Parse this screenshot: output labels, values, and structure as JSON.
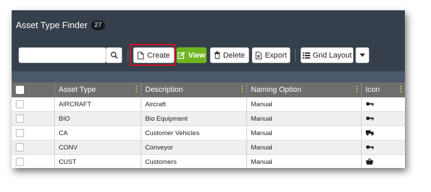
{
  "header": {
    "title": "Asset Type Finder",
    "count": "27"
  },
  "toolbar": {
    "search_placeholder": "",
    "create_label": "Create",
    "view_label": "View",
    "delete_label": "Delete",
    "export_label": "Export",
    "grid_label": "Grid Layout"
  },
  "table": {
    "columns": [
      "Asset Type",
      "Description",
      "Naming Option",
      "Icon"
    ],
    "rows": [
      {
        "type": "AIRCRAFT",
        "description": "Aircraft",
        "naming": "Manual",
        "icon": "key-icon"
      },
      {
        "type": "BIO",
        "description": "Bio Equipment",
        "naming": "Manual",
        "icon": "key-icon"
      },
      {
        "type": "CA",
        "description": "Customer Vehicles",
        "naming": "Manual",
        "icon": "truck-icon"
      },
      {
        "type": "CONV",
        "description": "Conveyor",
        "naming": "Manual",
        "icon": "key-icon"
      },
      {
        "type": "CUST",
        "description": "Customers",
        "naming": "Manual",
        "icon": "basket-icon"
      }
    ]
  },
  "colors": {
    "header_bg": "#36404c",
    "view_button": "#6fb51f",
    "highlight": "#d0132a"
  }
}
